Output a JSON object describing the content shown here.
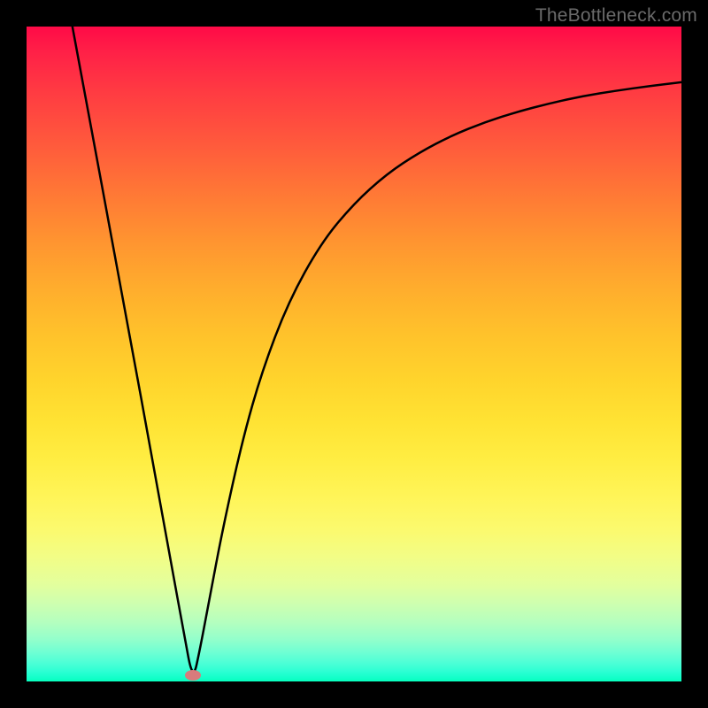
{
  "watermark": {
    "text": "TheBottleneck.com"
  },
  "chart_data": {
    "type": "line",
    "title": "",
    "xlabel": "",
    "ylabel": "",
    "xlim": [
      0,
      100
    ],
    "ylim": [
      0,
      100
    ],
    "grid": false,
    "legend": false,
    "background_gradient": {
      "direction": "vertical",
      "top_color": "#ff0a47",
      "bottom_color": "#06ffbd",
      "stops": [
        {
          "y": 0,
          "color": "#ff0a47"
        },
        {
          "y": 50,
          "color": "#ffc52b"
        },
        {
          "y": 80,
          "color": "#f0fd80"
        },
        {
          "y": 100,
          "color": "#06ffbd"
        }
      ]
    },
    "marker": {
      "x": 25.4,
      "y": 0.9,
      "color": "#d87b7c"
    },
    "series": [
      {
        "name": "curve",
        "color": "#000000",
        "x": [
          7.0,
          10.0,
          13.0,
          16.0,
          19.0,
          22.0,
          24.0,
          25.4,
          26.5,
          28.0,
          30.0,
          33.0,
          36.0,
          40.0,
          45.0,
          50.0,
          55.0,
          60.0,
          65.0,
          70.0,
          75.0,
          80.0,
          85.0,
          90.0,
          95.0,
          100.0
        ],
        "y": [
          100.0,
          84.0,
          67.5,
          51.5,
          35.0,
          18.5,
          7.5,
          0.0,
          5.0,
          13.0,
          23.5,
          37.0,
          47.5,
          58.0,
          67.0,
          73.0,
          77.5,
          80.8,
          83.4,
          85.4,
          87.0,
          88.3,
          89.4,
          90.2,
          90.9,
          91.5
        ]
      }
    ]
  }
}
